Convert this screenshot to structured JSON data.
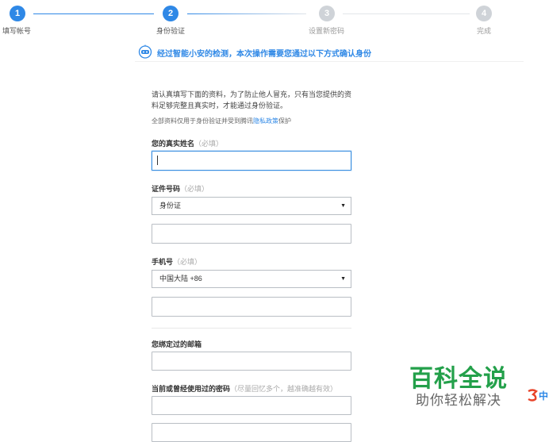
{
  "stepper": {
    "steps": [
      {
        "number": "1",
        "label": "填写帐号"
      },
      {
        "number": "2",
        "label": "身份验证"
      },
      {
        "number": "3",
        "label": "设置新密码"
      },
      {
        "number": "4",
        "label": "完成"
      }
    ],
    "current_step": 2,
    "colors": {
      "active": "#2f88e6",
      "inactive": "#cfd3d8"
    }
  },
  "notice": {
    "text": "经过智能小安的检测，本次操作需要您通过以下方式确认身份",
    "icon": "robot-assistant-icon"
  },
  "intro": {
    "text": "请认真填写下面的资料，为了防止他人冒充，只有当您提供的资料足够完整且真实时，才能通过身份验证。",
    "privacy_prefix": "全部资料仅用于身份验证并受到腾讯",
    "privacy_link": "隐私政策",
    "privacy_suffix": "保护"
  },
  "form": {
    "real_name": {
      "label": "您的真实姓名",
      "hint": "（必填）",
      "value": ""
    },
    "id_number": {
      "label": "证件号码",
      "hint": "（必填）",
      "type_selected": "身份证",
      "value": ""
    },
    "phone": {
      "label": "手机号",
      "hint": "（必填）",
      "region_selected": "中国大陆 +86",
      "value": ""
    },
    "email": {
      "label": "您绑定过的邮箱",
      "value": ""
    },
    "passwords": {
      "label": "当前或曾经使用过的密码",
      "hint": "（尽量回忆多个，越准确越有效）",
      "value": ""
    }
  },
  "watermark": {
    "title": "百科全说",
    "subtitle": "助你轻松解决",
    "logo_text": "中",
    "title_color": "#23a04a"
  }
}
